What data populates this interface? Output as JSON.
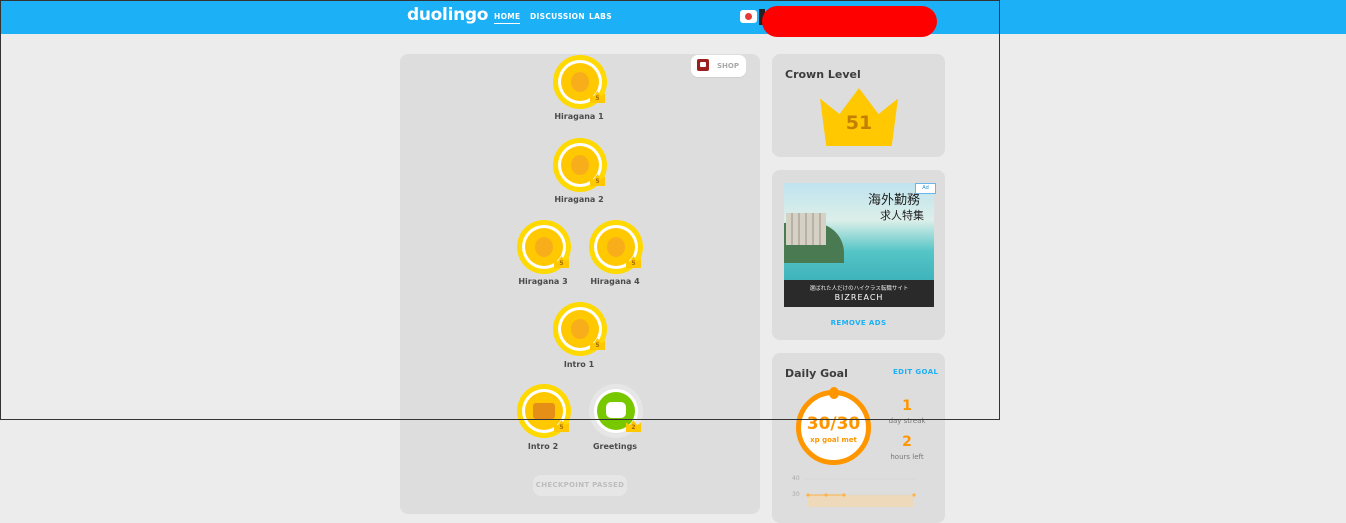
{
  "header": {
    "logo": "duolingo",
    "nav": [
      {
        "label": "HOME",
        "active": true
      },
      {
        "label": "DISCUSSION",
        "active": false
      },
      {
        "label": "LABS",
        "active": false
      }
    ],
    "brand_color": "#1cb0f6"
  },
  "shop": {
    "label": "SHOP",
    "icon": "treasure-chest-icon"
  },
  "skills": [
    {
      "name": "Hiragana 1",
      "crown_level": "5",
      "icon": "egg-icon"
    },
    {
      "name": "Hiragana 2",
      "crown_level": "5",
      "icon": "egg-icon"
    },
    {
      "name": "Hiragana 3",
      "crown_level": "5",
      "icon": "egg-icon"
    },
    {
      "name": "Hiragana 4",
      "crown_level": "5",
      "icon": "egg-icon"
    },
    {
      "name": "Intro 1",
      "crown_level": "5",
      "icon": "egg-icon"
    },
    {
      "name": "Intro 2",
      "crown_level": "5",
      "icon": "suitcase-icon"
    },
    {
      "name": "Greetings",
      "crown_level": "2",
      "icon": "speech-bubbles-icon"
    }
  ],
  "checkpoint": {
    "label": "CHECKPOINT PASSED"
  },
  "crown_level": {
    "title": "Crown Level",
    "value": "51"
  },
  "ad": {
    "title": "海外勤務",
    "subtitle": "求人特集",
    "tagline": "選ばれた人だけのハイクラス転職サイト",
    "brand": "BIZREACH",
    "badge": "Ad",
    "remove_label": "REMOVE ADS"
  },
  "daily_goal": {
    "title": "Daily Goal",
    "edit_label": "EDIT GOAL",
    "progress_value": "30/30",
    "progress_caption": "xp goal met",
    "streak_value": "1",
    "streak_label": "day streak",
    "hours_value": "2",
    "hours_label": "hours left",
    "chart_ticks": [
      "40",
      "30"
    ],
    "accent_color": "#ff9600"
  }
}
